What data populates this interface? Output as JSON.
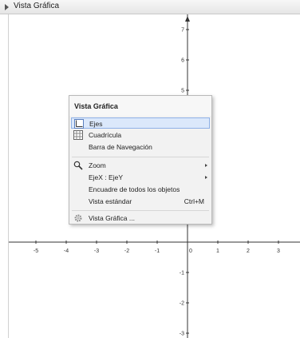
{
  "window": {
    "title": "Vista Gráfica"
  },
  "axes": {
    "x_tick_labels": [
      "-5",
      "-4",
      "-3",
      "-2",
      "-1",
      "0",
      "1",
      "2",
      "3"
    ],
    "y_tick_labels": [
      "7",
      "6",
      "5",
      "-1",
      "-2",
      "-3"
    ]
  },
  "context_menu": {
    "title": "Vista Gráfica",
    "items": [
      {
        "label": "Ejes",
        "shortcut": "",
        "icon": "axes-icon",
        "submenu": false,
        "selected": true
      },
      {
        "label": "Cuadrícula",
        "shortcut": "",
        "icon": "grid-icon",
        "submenu": false,
        "selected": false
      },
      {
        "label": "Barra de Navegación",
        "shortcut": "",
        "icon": "",
        "submenu": false,
        "selected": false
      },
      {
        "label": "Zoom",
        "shortcut": "",
        "icon": "magnifier-icon",
        "submenu": true,
        "selected": false
      },
      {
        "label": "EjeX : EjeY",
        "shortcut": "",
        "icon": "",
        "submenu": true,
        "selected": false
      },
      {
        "label": "Encuadre de todos los objetos",
        "shortcut": "",
        "icon": "",
        "submenu": false,
        "selected": false
      },
      {
        "label": "Vista estándar",
        "shortcut": "Ctrl+M",
        "icon": "",
        "submenu": false,
        "selected": false
      },
      {
        "label": "Vista Gráfica ...",
        "shortcut": "",
        "icon": "settings-gear-icon",
        "submenu": false,
        "selected": false
      }
    ]
  },
  "colors": {
    "axis": "#333333",
    "selection_bg": "#dbe8fb",
    "selection_border": "#8fb1e6",
    "menu_bg": "#f2f2f2"
  }
}
